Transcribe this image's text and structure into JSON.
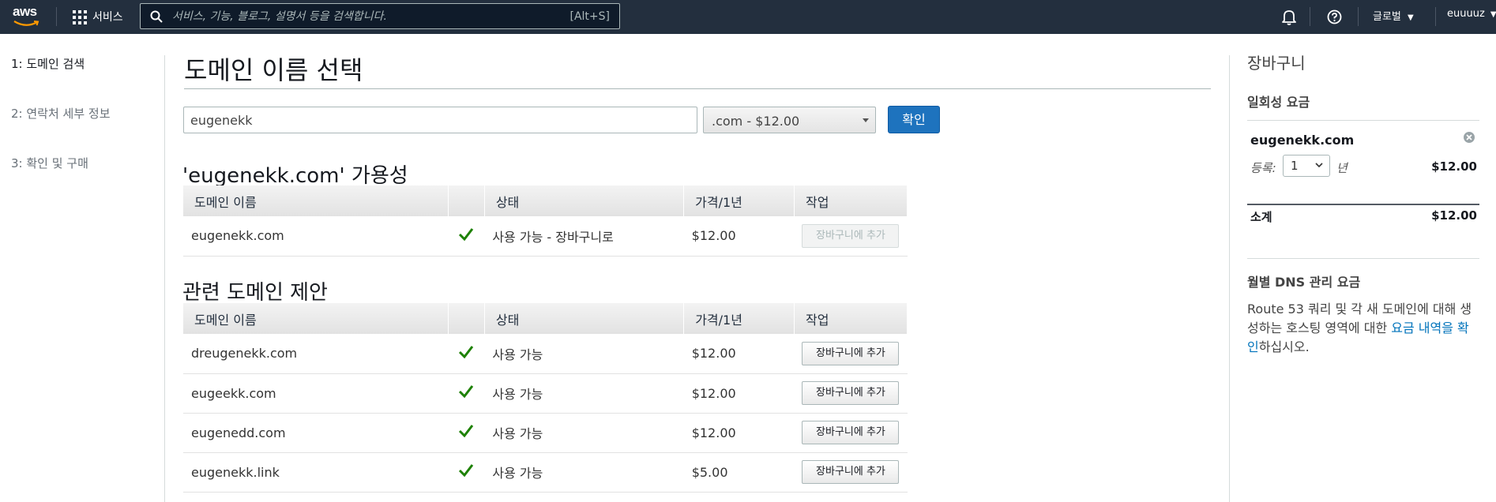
{
  "topbar": {
    "logo": "aws",
    "services_label": "서비스",
    "search_placeholder": "서비스, 기능, 블로그, 설명서 등을 검색합니다.",
    "search_shortcut": "[Alt+S]",
    "region_label": "글로벌",
    "user_label": "euuuuz",
    "icons": [
      "grid-icon",
      "search-icon",
      "bell-icon",
      "help-icon"
    ]
  },
  "steps": [
    {
      "label": "1: 도메인 검색",
      "active": true
    },
    {
      "label": "2: 연락처 세부 정보",
      "active": false
    },
    {
      "label": "3: 확인 및 구매",
      "active": false
    }
  ],
  "main": {
    "title": "도메인 이름 선택",
    "domain_input": "eugenekk",
    "tld_select": ".com - $12.00",
    "confirm_button": "확인"
  },
  "availability": {
    "title": "'eugenekk.com' 가용성",
    "headers": [
      "도메인 이름",
      "",
      "상태",
      "가격/1년",
      "작업"
    ],
    "rows": [
      {
        "domain": "eugenekk.com",
        "status": "사용 가능 - 장바구니로",
        "price": "$12.00",
        "action": "장바구니에 추가",
        "disabled": true
      }
    ]
  },
  "related": {
    "title": "관련 도메인 제안",
    "headers": [
      "도메인 이름",
      "",
      "상태",
      "가격/1년",
      "작업"
    ],
    "rows": [
      {
        "domain": "dreugenekk.com",
        "status": "사용 가능",
        "price": "$12.00",
        "action": "장바구니에 추가"
      },
      {
        "domain": "eugeekk.com",
        "status": "사용 가능",
        "price": "$12.00",
        "action": "장바구니에 추가"
      },
      {
        "domain": "eugenedd.com",
        "status": "사용 가능",
        "price": "$12.00",
        "action": "장바구니에 추가"
      },
      {
        "domain": "eugenekk.link",
        "status": "사용 가능",
        "price": "$5.00",
        "action": "장바구니에 추가"
      }
    ]
  },
  "cart": {
    "title": "장바구니",
    "one_time_label": "일회성 요금",
    "domain": "eugenekk.com",
    "register_label": "등록:",
    "years": "1",
    "year_unit": "년",
    "item_price": "$12.00",
    "subtotal_label": "소계",
    "subtotal": "$12.00",
    "dns_title": "월별 DNS 관리 요금",
    "dns_text_1": "Route 53 쿼리 및 각 새 도메인에 대해 생성하는 호스팅 영역에 대한 ",
    "dns_link": "요금 내역을 확인",
    "dns_text_2": "하십시오."
  },
  "colors": {
    "topbar": "#232f3e",
    "primary": "#1e73be",
    "check": "#1d8102",
    "link": "#0073bb"
  }
}
